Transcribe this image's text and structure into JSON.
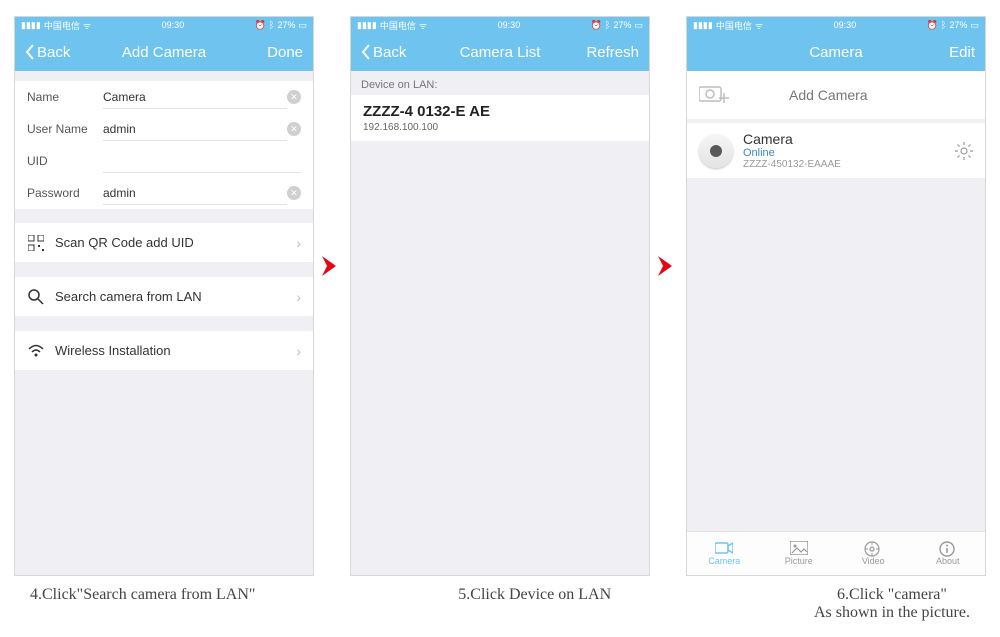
{
  "status": {
    "carrier": "中国电信",
    "time": "09:30",
    "battery": "27%"
  },
  "screen1": {
    "nav": {
      "back": "Back",
      "title": "Add Camera",
      "done": "Done"
    },
    "fields": {
      "name_label": "Name",
      "name_value": "Camera",
      "user_label": "User Name",
      "user_value": "admin",
      "uid_label": "UID",
      "uid_value": "",
      "pass_label": "Password",
      "pass_value": "admin"
    },
    "rows": {
      "qr": "Scan QR Code add UID",
      "lan": "Search camera from LAN",
      "wifi": "Wireless Installation"
    }
  },
  "screen2": {
    "nav": {
      "back": "Back",
      "title": "Camera List",
      "refresh": "Refresh"
    },
    "section": "Device on LAN:",
    "device": {
      "id": "ZZZZ-4 0132-E AE",
      "ip": "192.168.100.100"
    }
  },
  "screen3": {
    "nav": {
      "title": "Camera",
      "edit": "Edit"
    },
    "add": "Add Camera",
    "camera": {
      "name": "Camera",
      "status": "Online",
      "uid": "ZZZZ-450132-EAAAE"
    },
    "tabs": {
      "camera": "Camera",
      "picture": "Picture",
      "video": "Video",
      "about": "About"
    }
  },
  "captions": {
    "c1": "4.Click\"Search camera from LAN\"",
    "c2": "5.Click Device on LAN",
    "c3": "6.Click \"camera\"\nAs shown in the picture."
  }
}
